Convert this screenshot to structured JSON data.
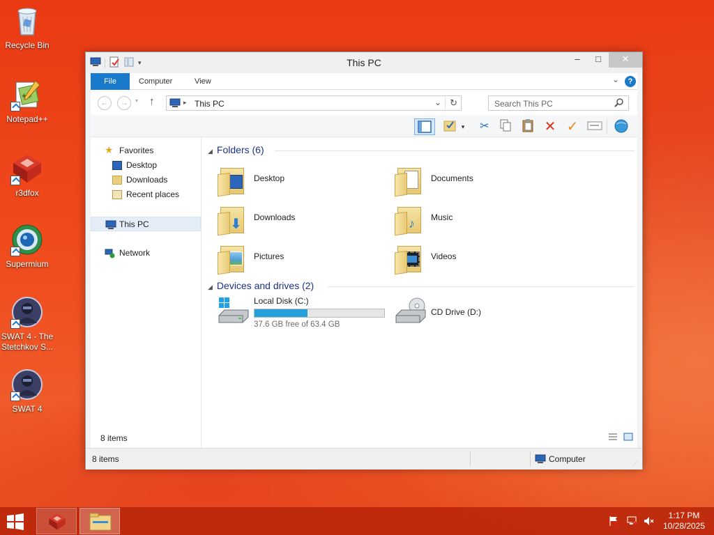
{
  "desktop": {
    "icons": [
      {
        "label": "Recycle Bin",
        "icon": "recycle-bin-icon"
      },
      {
        "label": "Notepad++",
        "icon": "notepadpp-icon"
      },
      {
        "label": "r3dfox",
        "icon": "r3dfox-icon"
      },
      {
        "label": "Supermium",
        "icon": "supermium-icon"
      },
      {
        "label": "SWAT 4 - The Stetchkov S...",
        "icon": "swat4-stetchkov-icon"
      },
      {
        "label": "SWAT 4",
        "icon": "swat4-icon"
      }
    ]
  },
  "window": {
    "title": "This PC",
    "ribbon_tabs": [
      "File",
      "Computer",
      "View"
    ],
    "address": "This PC",
    "search_placeholder": "Search This PC",
    "nav": {
      "favorites": "Favorites",
      "fav_items": [
        "Desktop",
        "Downloads",
        "Recent places"
      ],
      "this_pc": "This PC",
      "network": "Network"
    },
    "groups": {
      "folders_header": "Folders (6)",
      "folders": [
        "Desktop",
        "Documents",
        "Downloads",
        "Music",
        "Pictures",
        "Videos"
      ],
      "devices_header": "Devices and drives (2)"
    },
    "drives": [
      {
        "name": "Local Disk (C:)",
        "free": "37.6 GB free of 63.4 GB",
        "used_fraction": 0.407
      },
      {
        "name": "CD Drive (D:)"
      }
    ],
    "content_status": "8 items",
    "statusbar": {
      "left": "8 items",
      "right": "Computer"
    }
  },
  "taskbar": {
    "time": "1:17 PM",
    "date": "10/28/2025"
  },
  "colors": {
    "accent": "#1979ca",
    "drive_fill": "#26a0da",
    "header_text": "#1e3287"
  }
}
